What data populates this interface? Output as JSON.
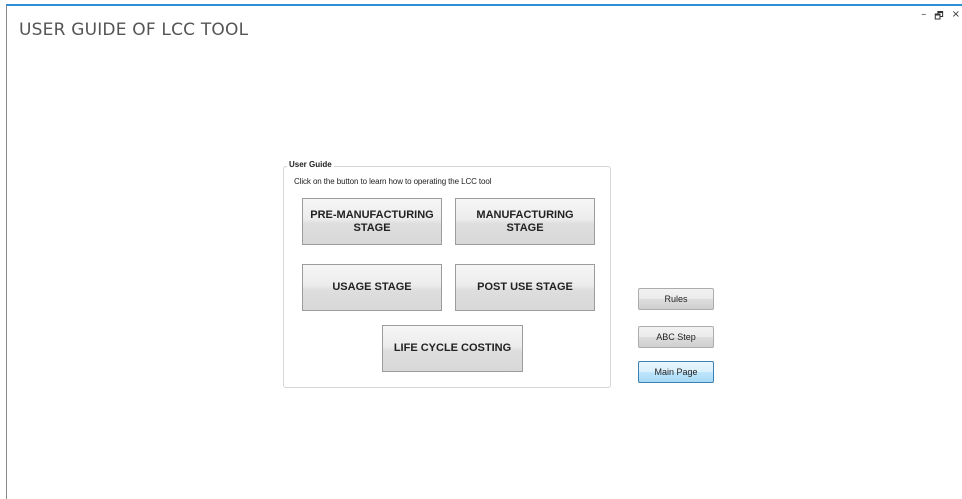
{
  "window": {
    "title": "USER GUIDE OF LCC TOOL",
    "controls": {
      "minimize": "–",
      "maximize": "🗗",
      "close": "×"
    }
  },
  "guide": {
    "legend": "User Guide",
    "instruction": "Click on the button to learn how to operating the LCC tool",
    "buttons": {
      "pre_manufacturing": "PRE-MANUFACTURING\nSTAGE",
      "manufacturing": "MANUFACTURING\nSTAGE",
      "usage": "USAGE STAGE",
      "post_use": "POST USE STAGE",
      "life_cycle": "LIFE CYCLE COSTING"
    }
  },
  "side": {
    "rules": "Rules",
    "abc_step": "ABC Step",
    "main_page": "Main Page"
  },
  "colors": {
    "title_bar_accent": "#2b8fd6",
    "active_button": "#bee6fd"
  }
}
